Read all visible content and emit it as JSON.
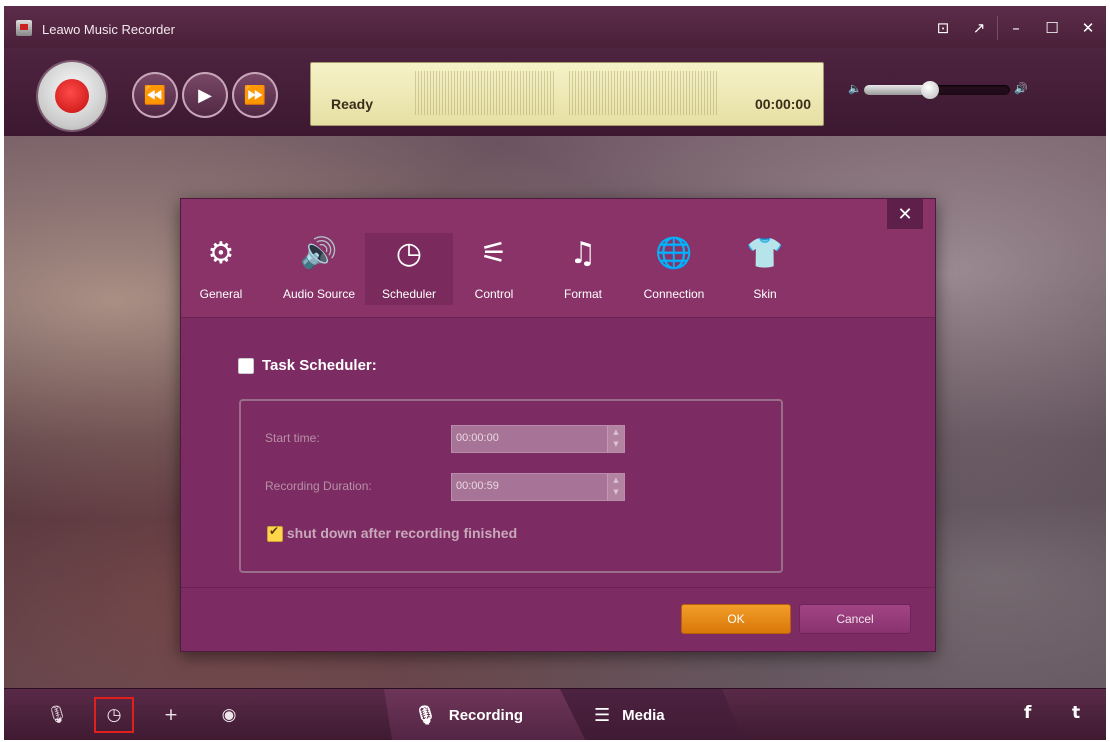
{
  "app": {
    "title": "Leawo Music Recorder"
  },
  "window_controls": [
    {
      "name": "skin-menu-button",
      "icon": "⊡"
    },
    {
      "name": "mini-mode-button",
      "icon": "↗"
    },
    {
      "name": "minimize-button",
      "icon": "–"
    },
    {
      "name": "maximize-button",
      "icon": "☐"
    },
    {
      "name": "close-button",
      "icon": "✕"
    }
  ],
  "player": {
    "status": "Ready",
    "time": "00:00:00",
    "rewind_icon": "⏪",
    "play_icon": "▶",
    "forward_icon": "⏩",
    "volume_low_icon": "🔈",
    "volume_high_icon": "🔊",
    "volume_level": 0.45
  },
  "dialog": {
    "close_icon": "✕",
    "tabs": [
      {
        "label": "General",
        "icon": "⚙"
      },
      {
        "label": "Audio Source",
        "icon": "🔊"
      },
      {
        "label": "Scheduler",
        "icon": "◷"
      },
      {
        "label": "Control",
        "icon": "⚟"
      },
      {
        "label": "Format",
        "icon": "♫"
      },
      {
        "label": "Connection",
        "icon": "🌐"
      },
      {
        "label": "Skin",
        "icon": "👕"
      }
    ],
    "active_tab": "Scheduler",
    "task_scheduler": {
      "label": "Task Scheduler:",
      "checked": false
    },
    "start_time": {
      "label": "Start time:",
      "value": "00:00:00"
    },
    "duration": {
      "label": "Recording Duration:",
      "value": "00:00:59"
    },
    "shutdown": {
      "label": "shut down after recording finished",
      "checked": true
    },
    "ok_label": "OK",
    "cancel_label": "Cancel"
  },
  "bottom": {
    "mic_icon": "🎙",
    "scheduler_icon": "◷",
    "add_icon": "+",
    "disc_icon": "◉",
    "recording_tab": "Recording",
    "media_tab": "Media",
    "facebook": "f",
    "tumblr": "t"
  }
}
